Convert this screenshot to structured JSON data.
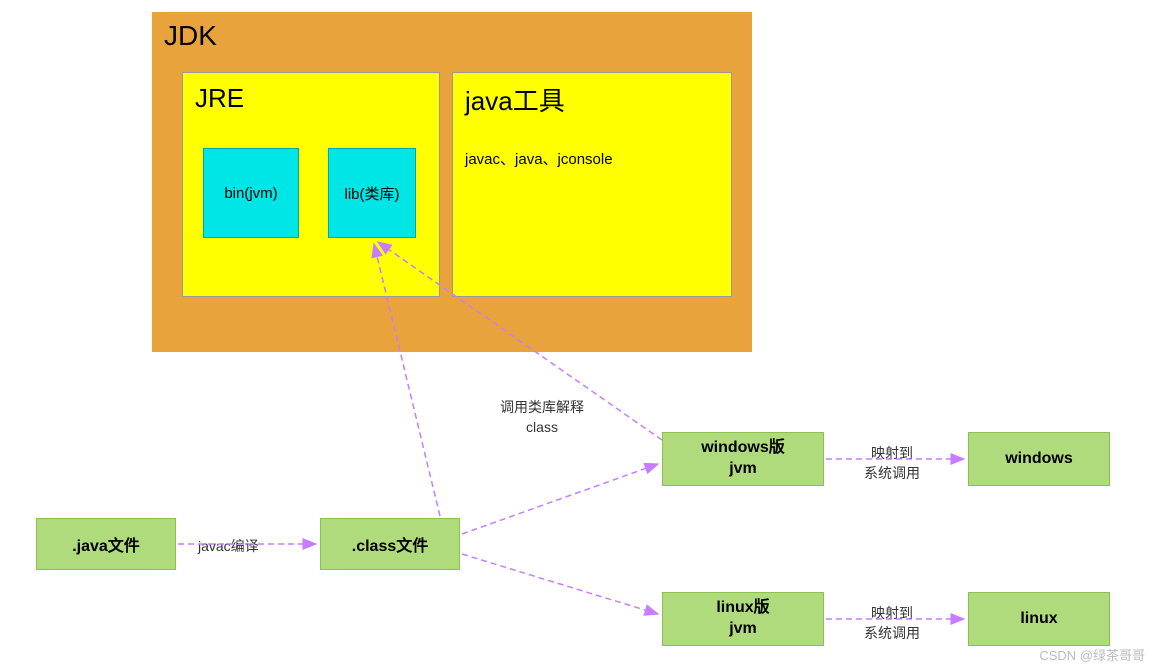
{
  "jdk": {
    "title": "JDK"
  },
  "jre": {
    "title": "JRE",
    "bin": "bin(jvm)",
    "lib": "lib(类库)"
  },
  "tools": {
    "title": "java工具",
    "list": "javac、java、jconsole"
  },
  "nodes": {
    "java_file": ".java文件",
    "class_file": ".class文件",
    "win_jvm_l1": "windows版",
    "win_jvm_l2": "jvm",
    "linux_jvm_l1": "linux版",
    "linux_jvm_l2": "jvm",
    "windows": "windows",
    "linux": "linux"
  },
  "labels": {
    "javac": "javac编译",
    "call_lib_l1": "调用类库解释",
    "call_lib_l2": "class",
    "map_l1": "映射到",
    "map_l2": "系统调用"
  },
  "watermark": "CSDN @绿茶哥哥",
  "colors": {
    "arrow": "#c77dff"
  }
}
